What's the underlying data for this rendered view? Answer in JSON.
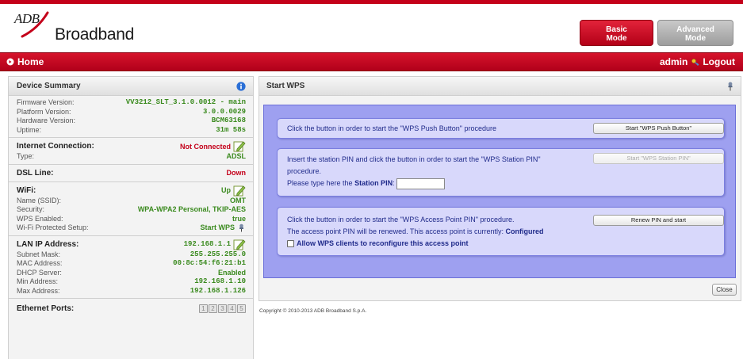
{
  "brand": {
    "logo_prefix": "ADB",
    "logo_name": "Broadband",
    "accent_color": "#c4001a"
  },
  "header": {
    "basic_mode": "Basic\nMode",
    "advanced_mode": "Advanced\nMode"
  },
  "nav": {
    "home_label": "Home",
    "user": "admin",
    "logout_label": "Logout"
  },
  "sidebar": {
    "title": "Device Summary",
    "device": [
      {
        "label": "Firmware Version:",
        "value": "VV3212_SLT_3.1.0.0012 - main"
      },
      {
        "label": "Platform Version:",
        "value": "3.0.0.0029"
      },
      {
        "label": "Hardware Version:",
        "value": "BCM63168"
      },
      {
        "label": "Uptime:",
        "value": "31m 58s"
      }
    ],
    "internet": {
      "title": "Internet Connection:",
      "status": "Not Connected",
      "type_label": "Type:",
      "type_value": "ADSL"
    },
    "dsl": {
      "title": "DSL Line:",
      "status": "Down"
    },
    "wifi": {
      "title": "WiFi:",
      "status": "Up",
      "rows": [
        {
          "label": "Name (SSID):",
          "value": "OMT"
        },
        {
          "label": "Security:",
          "value": "WPA-WPA2 Personal, TKIP-AES"
        },
        {
          "label": "WPS Enabled:",
          "value": "true"
        },
        {
          "label": "Wi-Fi Protected Setup:",
          "value": "Start WPS"
        }
      ]
    },
    "lan": {
      "title": "LAN IP Address:",
      "ip": "192.168.1.1",
      "rows": [
        {
          "label": "Subnet Mask:",
          "value": "255.255.255.0"
        },
        {
          "label": "MAC Address:",
          "value": "00:8c:54:f6:21:b1"
        },
        {
          "label": "DHCP Server:",
          "value": "Enabled"
        },
        {
          "label": "Min Address:",
          "value": "192.168.1.10"
        },
        {
          "label": "Max Address:",
          "value": "192.168.1.126"
        }
      ]
    },
    "ethernet": {
      "title": "Ethernet Ports:",
      "ports": [
        "1",
        "2",
        "3",
        "4",
        "5"
      ]
    }
  },
  "main": {
    "title": "Start WPS",
    "push": {
      "text": "Click the button in order to start the \"WPS Push Button\" procedure",
      "button": "Start \"WPS Push Button\""
    },
    "station": {
      "text1": "Insert the station PIN and click the button in order to start the \"WPS Station PIN\"",
      "text2": "procedure.",
      "prompt": "Please type here the ",
      "prompt_bold": "Station PIN",
      "prompt_end": ":",
      "pin_value": "",
      "button": "Start \"WPS Station PIN\""
    },
    "ap": {
      "text1": "Click the button in order to start the \"WPS Access Point PIN\" procedure.",
      "text2": "The access point PIN will be renewed. This access point is currently: ",
      "status": "Configured",
      "checkbox_label": "Allow WPS clients to reconfigure this access point",
      "button": "Renew PIN and start"
    },
    "close": "Close"
  },
  "footer": {
    "copyright": "Copyright © 2010-2013 ADB Broadband S.p.A."
  }
}
